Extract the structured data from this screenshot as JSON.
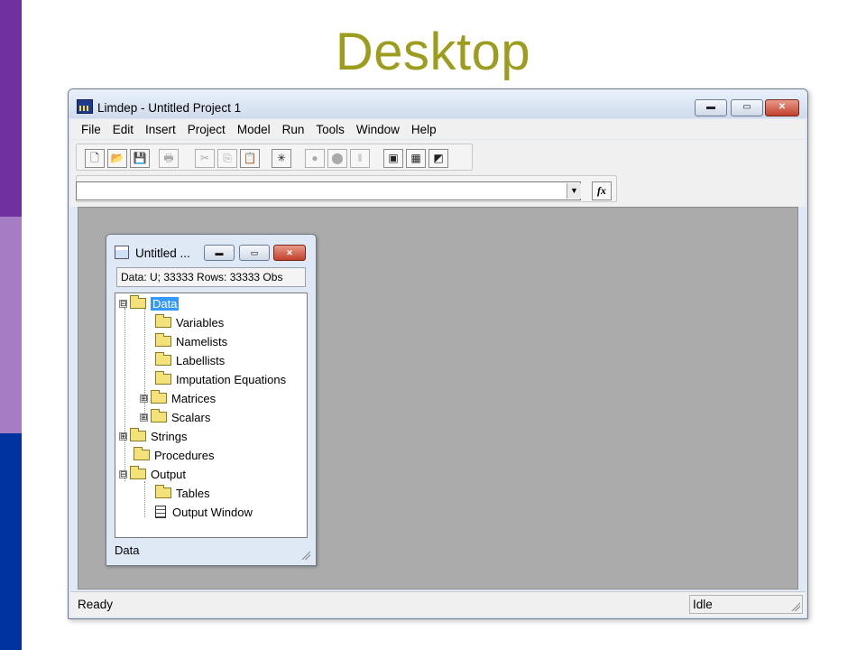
{
  "slide": {
    "title": "Desktop",
    "colors": {
      "stripe_top": "#7030a0",
      "stripe_mid": "#a57dc5",
      "stripe_bottom": "#0033a0",
      "title": "#9c9c1d"
    }
  },
  "app": {
    "title": "Limdep - Untitled Project 1",
    "icon": "limdep-app-icon",
    "window_buttons": {
      "minimize": "minimize-icon",
      "maximize": "maximize-icon",
      "close": "close-icon"
    },
    "menu": [
      "File",
      "Edit",
      "Insert",
      "Project",
      "Model",
      "Run",
      "Tools",
      "Window",
      "Help"
    ],
    "toolbar": [
      {
        "name": "new-file",
        "glyph": "🗋",
        "enabled": true
      },
      {
        "name": "open-folder",
        "glyph": "📂",
        "enabled": true
      },
      {
        "name": "save",
        "glyph": "💾",
        "enabled": true
      },
      {
        "name": "print",
        "glyph": "🖶",
        "enabled": false
      },
      {
        "name": "cut",
        "glyph": "✂",
        "enabled": false
      },
      {
        "name": "copy",
        "glyph": "⎘",
        "enabled": false
      },
      {
        "name": "paste",
        "glyph": "📋",
        "enabled": true
      },
      {
        "name": "star",
        "glyph": "✳",
        "enabled": true
      },
      {
        "name": "go",
        "glyph": "●",
        "enabled": false
      },
      {
        "name": "stop",
        "glyph": "⬤",
        "enabled": false
      },
      {
        "name": "pause",
        "glyph": "‖",
        "enabled": false
      },
      {
        "name": "project-window",
        "glyph": "▣",
        "enabled": true
      },
      {
        "name": "data-grid",
        "glyph": "▦",
        "enabled": true
      },
      {
        "name": "output-window",
        "glyph": "◩",
        "enabled": true
      }
    ],
    "command": {
      "value": "",
      "dropdown_icon": "chevron-down-icon",
      "fx_label": "fx"
    },
    "status": {
      "left": "Ready",
      "right": "Idle"
    }
  },
  "project_window": {
    "title": "Untitled ...",
    "info": "Data: U; 33333 Rows: 33333 Obs",
    "status": "Data",
    "tree": [
      {
        "label": "Data",
        "expander": "⊟",
        "icon": "folder-open-icon",
        "selected": true
      },
      {
        "label": "Variables",
        "icon": "folder-icon"
      },
      {
        "label": "Namelists",
        "icon": "folder-icon"
      },
      {
        "label": "Labellists",
        "icon": "folder-icon"
      },
      {
        "label": "Imputation Equations",
        "icon": "folder-icon"
      },
      {
        "label": "Matrices",
        "expander": "⊞",
        "icon": "folder-icon"
      },
      {
        "label": "Scalars",
        "expander": "⊞",
        "icon": "folder-icon"
      },
      {
        "label": "Strings",
        "expander": "⊞",
        "icon": "folder-icon"
      },
      {
        "label": "Procedures",
        "icon": "folder-icon"
      },
      {
        "label": "Output",
        "expander": "⊟",
        "icon": "folder-open-icon"
      },
      {
        "label": "Tables",
        "icon": "folder-icon"
      },
      {
        "label": "Output Window",
        "icon": "document-icon"
      }
    ]
  }
}
